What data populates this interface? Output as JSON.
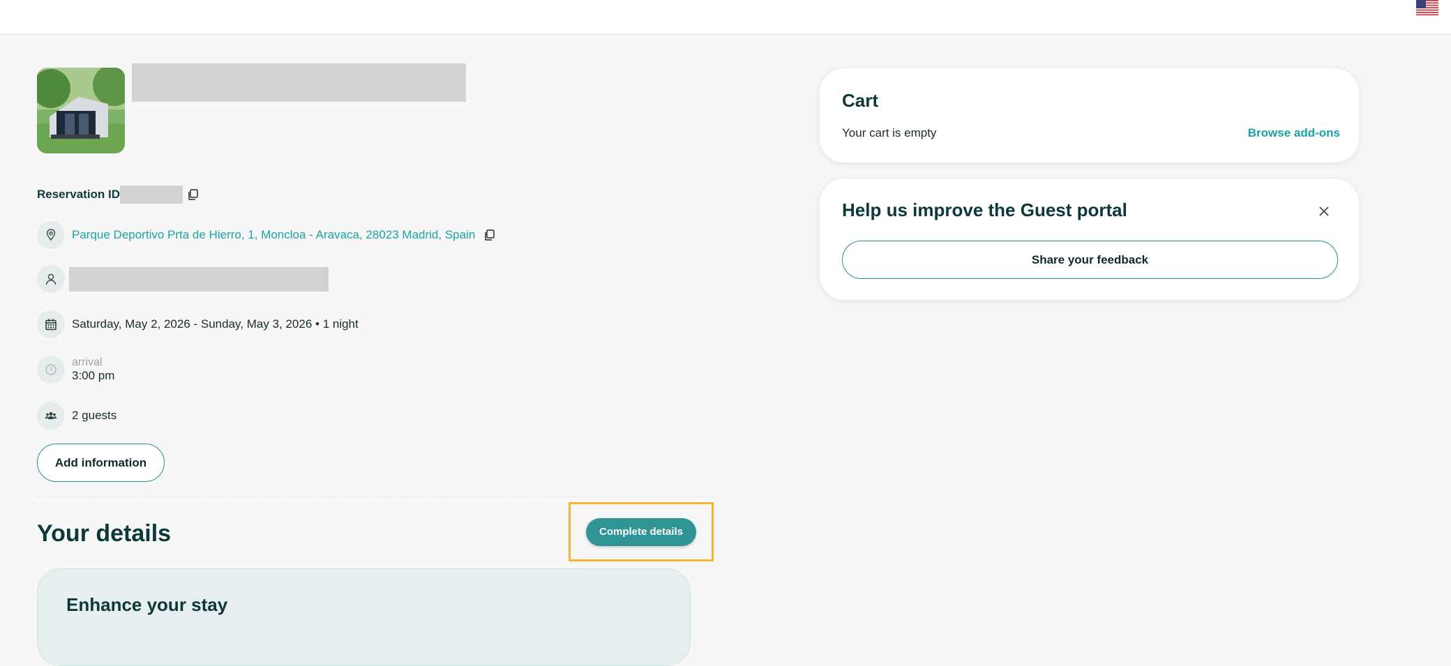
{
  "header": {
    "language_flag": "us-flag-icon"
  },
  "reservation": {
    "id_label": "Reservation ID",
    "address": "Parque Deportivo Prta de Hierro, 1, Moncloa - Aravaca, 28023 Madrid, Spain",
    "dates": "Saturday, May 2, 2026 - Sunday, May 3, 2026 • 1 night",
    "arrival_label": "arrival",
    "arrival_time": "3:00 pm",
    "guests": "2 guests",
    "add_info_label": "Add information"
  },
  "details": {
    "heading": "Your details",
    "complete_button": "Complete details",
    "enhance_heading": "Enhance your stay"
  },
  "cart": {
    "title": "Cart",
    "empty_text": "Your cart is empty",
    "browse_link": "Browse add-ons"
  },
  "feedback": {
    "title": "Help us improve the Guest portal",
    "button": "Share your feedback"
  },
  "colors": {
    "accent": "#2e9494",
    "link": "#1aa3a3",
    "highlight": "#f5b731"
  }
}
